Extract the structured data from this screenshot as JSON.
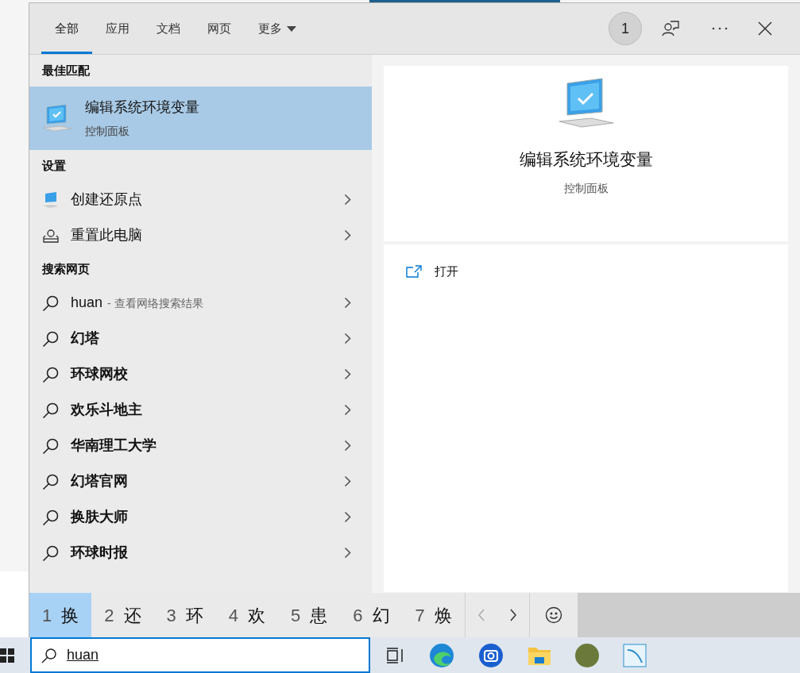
{
  "tabs": [
    {
      "label": "全部",
      "selected": true
    },
    {
      "label": "应用",
      "selected": false
    },
    {
      "label": "文档",
      "selected": false
    },
    {
      "label": "网页",
      "selected": false
    },
    {
      "label": "更多",
      "selected": false,
      "dropdown": true
    }
  ],
  "header": {
    "badge": "1"
  },
  "best_match": {
    "heading": "最佳匹配",
    "item": {
      "title": "编辑系统环境变量",
      "subtitle": "控制面板",
      "selected": true
    }
  },
  "settings": {
    "heading": "设置",
    "items": [
      {
        "label": "创建还原点",
        "kind": "monitor"
      },
      {
        "label": "重置此电脑",
        "kind": "reset"
      }
    ]
  },
  "web": {
    "heading": "搜索网页",
    "items": [
      {
        "kind": "query",
        "label": "huan",
        "hint": "- 查看网络搜索结果"
      },
      {
        "kind": "suggestion",
        "label": "幻塔"
      },
      {
        "kind": "suggestion",
        "label": "环球网校"
      },
      {
        "kind": "suggestion",
        "label": "欢乐斗地主"
      },
      {
        "kind": "suggestion",
        "label": "华南理工大学"
      },
      {
        "kind": "suggestion",
        "label": "幻塔官网"
      },
      {
        "kind": "suggestion",
        "label": "换肤大师"
      },
      {
        "kind": "suggestion",
        "label": "环球时报"
      }
    ]
  },
  "preview": {
    "title": "编辑系统环境变量",
    "subtitle": "控制面板",
    "actions": [
      {
        "label": "打开"
      }
    ]
  },
  "ime": {
    "candidates": [
      {
        "index": "1",
        "char": "换",
        "selected": true
      },
      {
        "index": "2",
        "char": "还",
        "selected": false
      },
      {
        "index": "3",
        "char": "环",
        "selected": false
      },
      {
        "index": "4",
        "char": "欢",
        "selected": false
      },
      {
        "index": "5",
        "char": "患",
        "selected": false
      },
      {
        "index": "6",
        "char": "幻",
        "selected": false
      },
      {
        "index": "7",
        "char": "焕",
        "selected": false
      }
    ]
  },
  "taskbar": {
    "search_value": "huan"
  }
}
